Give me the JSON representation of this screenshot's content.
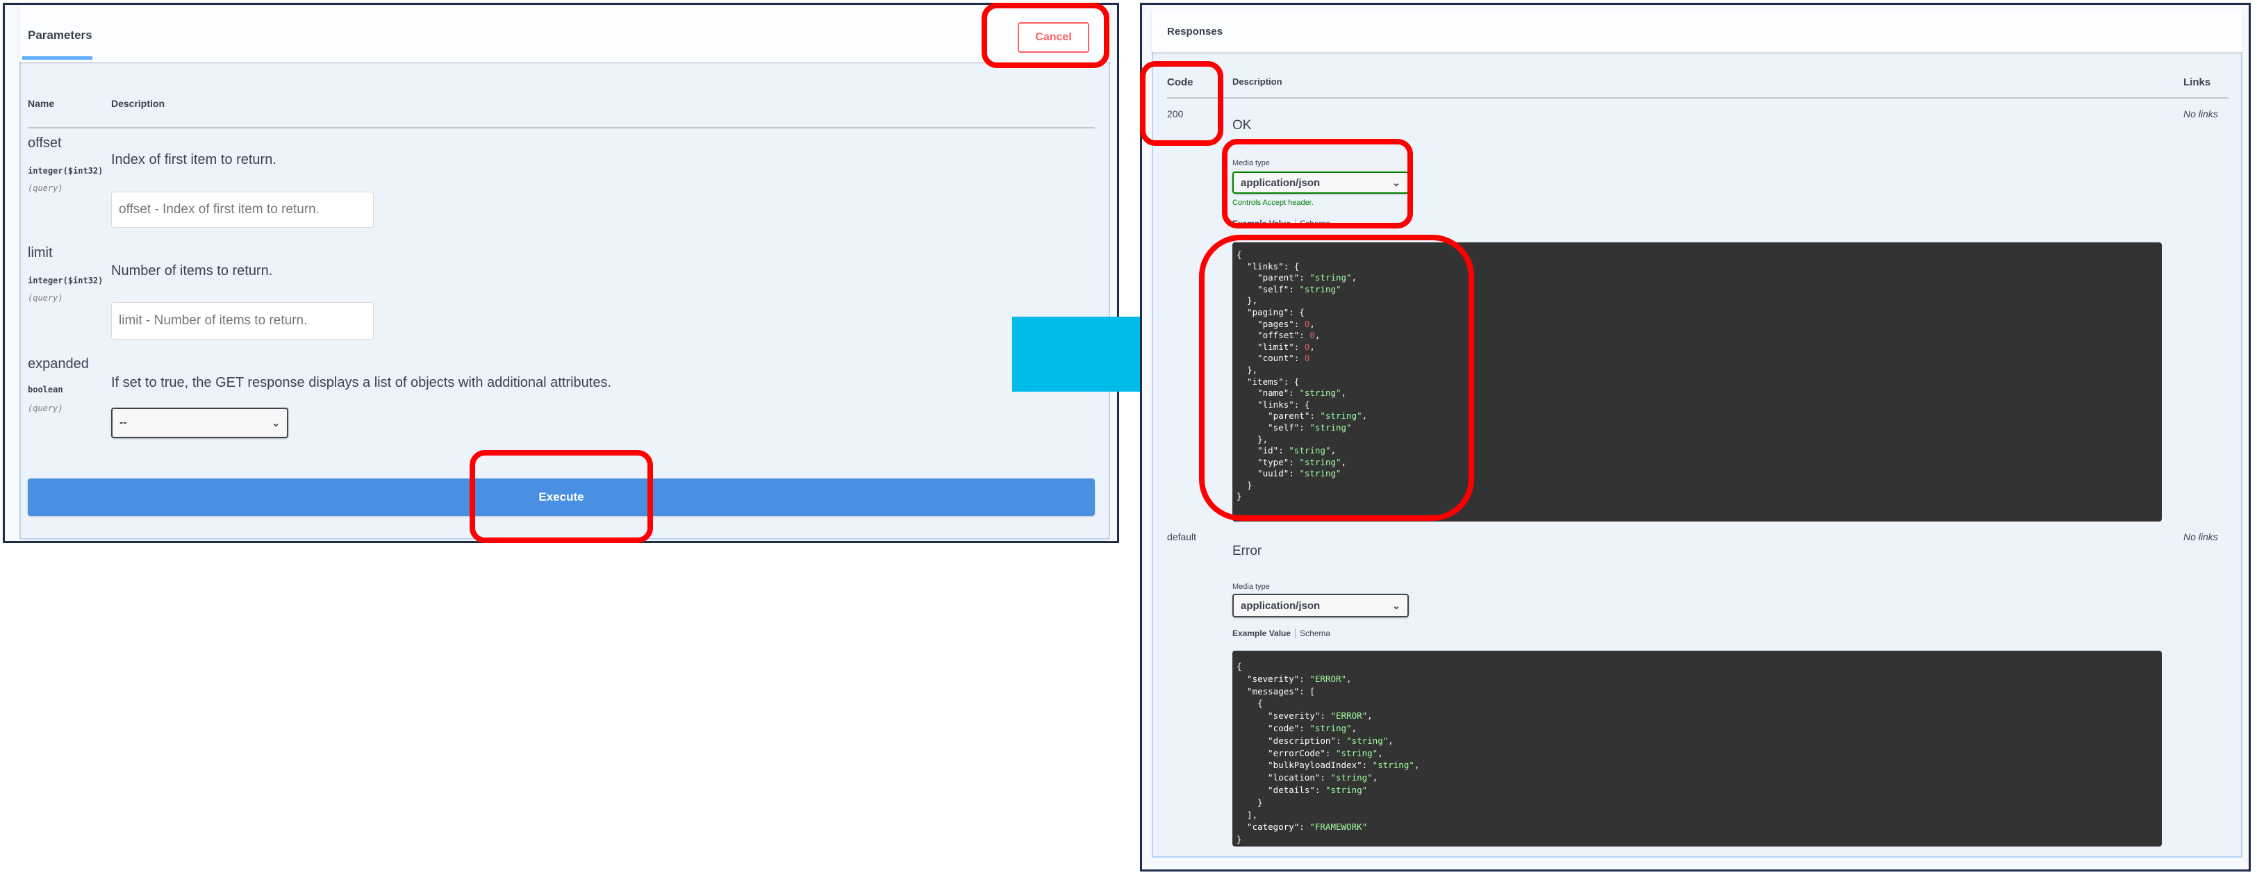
{
  "parameters_panel": {
    "title": "Parameters",
    "cancel_label": "Cancel",
    "columns": {
      "name": "Name",
      "description": "Description"
    },
    "params": [
      {
        "name": "offset",
        "type": "integer($int32)",
        "in": "(query)",
        "description": "Index of first item to return.",
        "placeholder": "offset - Index of first item to return."
      },
      {
        "name": "limit",
        "type": "integer($int32)",
        "in": "(query)",
        "description": "Number of items to return.",
        "placeholder": "limit - Number of items to return."
      },
      {
        "name": "expanded",
        "type": "boolean",
        "in": "(query)",
        "description": "If set to true, the GET response displays a list of objects with additional attributes.",
        "selected": "--"
      }
    ],
    "execute_label": "Execute"
  },
  "responses_panel": {
    "title": "Responses",
    "columns": {
      "code": "Code",
      "description": "Description",
      "links": "Links"
    },
    "responses": [
      {
        "code": "200",
        "description": "OK",
        "links": "No links",
        "media_type_label": "Media type",
        "media_type": "application/json",
        "media_hint": "Controls Accept header.",
        "tab_example": "Example Value",
        "tab_schema": "Schema",
        "example": [
          "{",
          "  \"links\": {",
          "    \"parent\": \"string\",",
          "    \"self\": \"string\"",
          "  },",
          "  \"paging\": {",
          "    \"pages\": 0,",
          "    \"offset\": 0,",
          "    \"limit\": 0,",
          "    \"count\": 0",
          "  },",
          "  \"items\": {",
          "    \"name\": \"string\",",
          "    \"links\": {",
          "      \"parent\": \"string\",",
          "      \"self\": \"string\"",
          "    },",
          "    \"id\": \"string\",",
          "    \"type\": \"string\",",
          "    \"uuid\": \"string\"",
          "  }",
          "}"
        ]
      },
      {
        "code": "default",
        "description": "Error",
        "links": "No links",
        "media_type_label": "Media type",
        "media_type": "application/json",
        "tab_example": "Example Value",
        "tab_schema": "Schema",
        "example": [
          "{",
          "  \"severity\": \"ERROR\",",
          "  \"messages\": [",
          "    {",
          "      \"severity\": \"ERROR\",",
          "      \"code\": \"string\",",
          "      \"description\": \"string\",",
          "      \"errorCode\": \"string\",",
          "      \"bulkPayloadIndex\": \"string\",",
          "      \"location\": \"string\",",
          "      \"details\": \"string\"",
          "    }",
          "  ],",
          "  \"category\": \"FRAMEWORK\"",
          "}"
        ]
      }
    ]
  },
  "colors": {
    "highlight": "#ff0000",
    "arrow": "#00bbe8",
    "execute": "#4990e2",
    "cancel": "#ff6060",
    "accent": "#61affe",
    "code_bg": "#333333"
  },
  "icons": {
    "arrow": "arrow-right-icon",
    "dropdown": "chevron-down-icon"
  }
}
